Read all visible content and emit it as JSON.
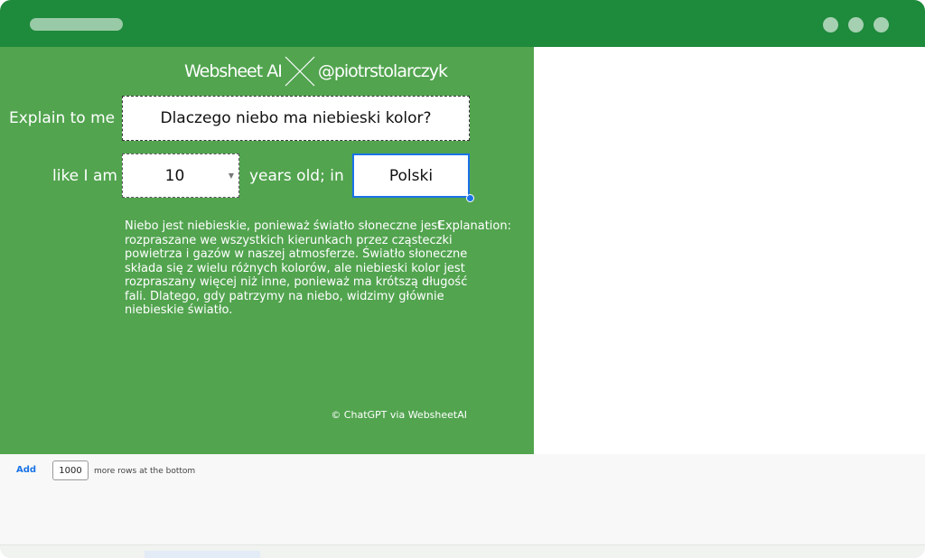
{
  "brand": {
    "name": "Websheet AI",
    "handle": "@piotrstolarczyk"
  },
  "form": {
    "explain_label": "Explain to me",
    "question_value": "Dlaczego niebo ma niebieski kolor?",
    "like_label": "like I am",
    "age_value": "10",
    "years_label": "years old; in",
    "language_value": "Polski"
  },
  "explanation": {
    "label": "Explanation:",
    "text": "Niebo jest niebieskie, ponieważ światło słoneczne jest rozpraszane we wszystkich kierunkach przez cząsteczki powietrza i gazów w naszej atmosferze. Światło słoneczne składa się z wielu różnych kolorów, ale niebieski kolor jest rozpraszany więcej niż inne, ponieważ ma krótszą długość fali. Dlatego, gdy patrzymy na niebo, widzimy głównie niebieskie światło."
  },
  "credit": "© ChatGPT via WebsheetAI",
  "footer": {
    "add_label": "Add",
    "rows_value": "1000",
    "rows_suffix": "more rows at the bottom"
  },
  "icons": {
    "cross": "x-mark-icon",
    "dropdown": "chevron-down-icon"
  },
  "colors": {
    "titlebar": "#1e8a3c",
    "panel": "#52a44f",
    "accent": "#1a73e8"
  }
}
